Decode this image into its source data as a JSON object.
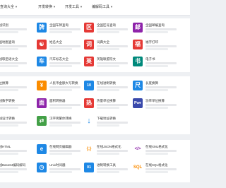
{
  "nav": [
    {
      "label": "查询大全"
    },
    {
      "label": "开发转换"
    },
    {
      "label": "开发工具"
    },
    {
      "label": "编解码工具"
    }
  ],
  "sections": [
    {
      "id": "query",
      "rows": [
        [
          {
            "name": "在线识别",
            "icon": "",
            "color": "#1e88e5"
          },
          {
            "name": "全国车牌查询",
            "icon": "牌",
            "color": "#1e88e5"
          },
          {
            "name": "全国区号查询",
            "icon": "区",
            "color": "#e53935"
          },
          {
            "name": "全国邮编查询",
            "icon": "邮",
            "color": "#8e24aa"
          }
        ],
        [
          {
            "name": "全国地图查询",
            "icon": "",
            "color": "#43a047"
          },
          {
            "name": "姓名大全",
            "icon": "☯",
            "color": "#e53935"
          },
          {
            "name": "词典大全",
            "icon": "词",
            "color": "#e53935"
          },
          {
            "name": "福字打印",
            "icon": "福",
            "color": "#e53935"
          }
        ],
        [
          {
            "name": "在线歇后语大全",
            "icon": "",
            "color": "#fb8c00"
          },
          {
            "name": "汽车标志大全",
            "icon": "车",
            "color": "#1e88e5"
          },
          {
            "name": "英雄联盟符文",
            "icon": "英",
            "color": "#e53935"
          },
          {
            "name": "电子书",
            "icon": "书",
            "color": "#00897b"
          }
        ]
      ]
    },
    {
      "id": "convert",
      "rows": [
        [
          {
            "name": "单位换算",
            "icon": "",
            "color": "#fb8c00"
          },
          {
            "name": "人民币金额大写转换",
            "icon": "¥",
            "color": "#fb8c00"
          },
          {
            "name": "在线进制转换",
            "icon": "10",
            "color": "#1e88e5"
          },
          {
            "name": "长度换算",
            "icon": "尺",
            "color": "#1e88e5"
          }
        ],
        [
          {
            "name": "在线数字转换",
            "icon": "",
            "color": "#1e88e5"
          },
          {
            "name": "面积转换器",
            "icon": "面",
            "color": "#8e24aa"
          },
          {
            "name": "热量单位换算",
            "icon": "热",
            "color": "#e53935"
          },
          {
            "name": "功率单位换算",
            "icon": "Pwr",
            "color": "#3949ab"
          }
        ],
        [
          {
            "name": "在线设计转换",
            "icon": "",
            "color": "#43a047"
          },
          {
            "name": "汉字简繁体转换",
            "icon": "⇄",
            "color": "#43a047"
          },
          {
            "name": "下载地址转换",
            "icon": "↓",
            "color": "#1e88e5"
          },
          {
            "name": "",
            "icon": "",
            "color": "#ffffff"
          }
        ]
      ]
    },
    {
      "id": "dev",
      "rows": [
        [
          {
            "name": "在线HTML",
            "icon": "",
            "color": "#1e88e5"
          },
          {
            "name": "在线网页编辑器",
            "icon": "e",
            "color": "#1e88e5"
          },
          {
            "name": "在线JSON格式化",
            "icon": "{;}",
            "color": "#fb8c00"
          },
          {
            "name": "在线XML格式化",
            "icon": "</>",
            "color": "#8e24aa"
          }
        ],
        [
          {
            "name": "在线Base64编码解码",
            "icon": "",
            "color": "#1e88e5"
          },
          {
            "name": "Unix时间戳",
            "icon": "◷",
            "color": "#1e88e5"
          },
          {
            "name": "进制转换工具",
            "icon": "01",
            "color": "#1e88e5"
          },
          {
            "name": "在线SQL格式化",
            "icon": "SQL",
            "color": "#fb8c00"
          }
        ]
      ]
    }
  ]
}
